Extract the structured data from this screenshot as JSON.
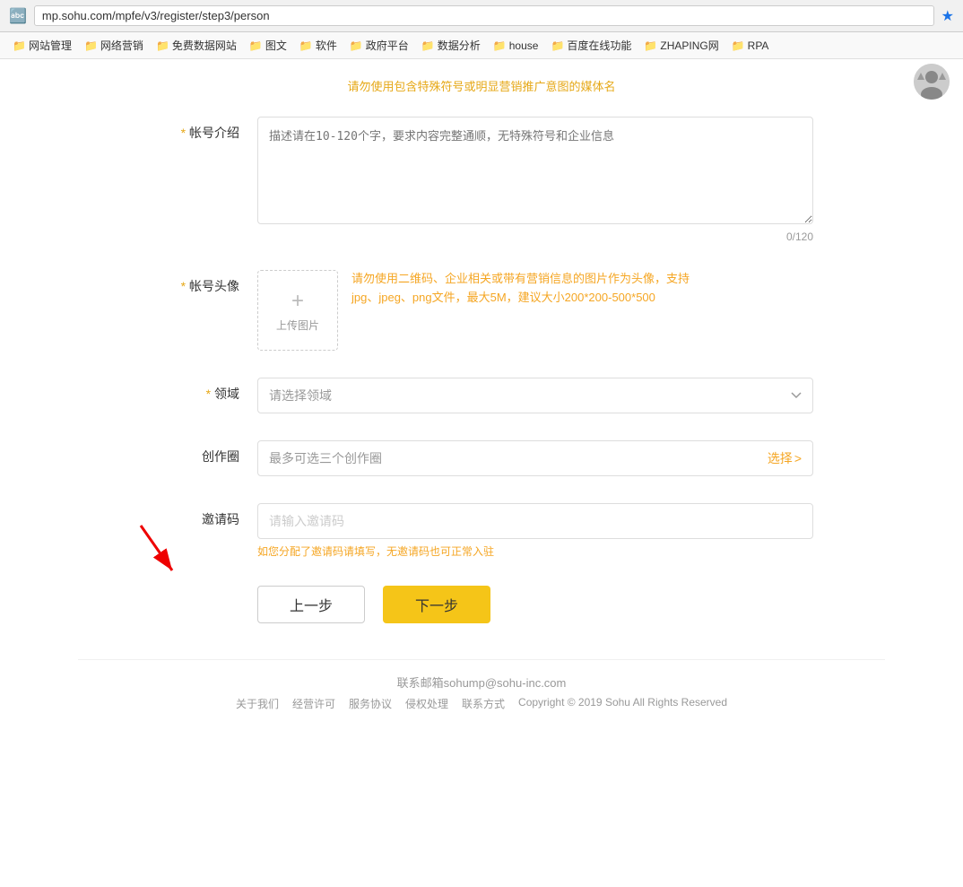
{
  "browser": {
    "url": "mp.sohu.com/mpfe/v3/register/step3/person",
    "translate_icon": "🔤",
    "star_icon": "★"
  },
  "bookmarks": [
    {
      "label": "网站管理"
    },
    {
      "label": "网络营销"
    },
    {
      "label": "免费数据网站"
    },
    {
      "label": "图文"
    },
    {
      "label": "软件"
    },
    {
      "label": "政府平台"
    },
    {
      "label": "数据分析"
    },
    {
      "label": "house"
    },
    {
      "label": "百度在线功能"
    },
    {
      "label": "ZHAPING网"
    },
    {
      "label": "RPA"
    }
  ],
  "form": {
    "warning_text": "请勿使用包含特殊符号或明显营销推广意图的媒体名",
    "account_intro": {
      "label": "* 帐号介绍",
      "placeholder": "描述请在10-120个字，要求内容完整通顺，无特殊符号和企业信息",
      "counter": "0/120"
    },
    "account_avatar": {
      "label": "* 帐号头像",
      "upload_label": "上传图片",
      "hint": "请勿使用二维码、企业相关或带有营销信息的图片作为头像，支持jpg、jpeg、png文件，最大5M，建议大小200*200-500*500"
    },
    "domain": {
      "label": "* 领域",
      "placeholder": "请选择领域"
    },
    "creation_circle": {
      "label": "创作圈",
      "placeholder": "最多可选三个创作圈",
      "btn_label": "选择",
      "btn_arrow": ">"
    },
    "invite_code": {
      "label": "邀请码",
      "placeholder": "请输入邀请码",
      "hint": "如您分配了邀请码请填写，无邀请码也可正常入驻"
    },
    "prev_btn": "上一步",
    "next_btn": "下一步"
  },
  "footer": {
    "contact": "联系邮箱sohump@sohu-inc.com",
    "links": [
      "关于我们",
      "经营许可",
      "服务协议",
      "侵权处理",
      "联系方式",
      "Copyright © 2019 Sohu All Rights Reserved"
    ]
  }
}
